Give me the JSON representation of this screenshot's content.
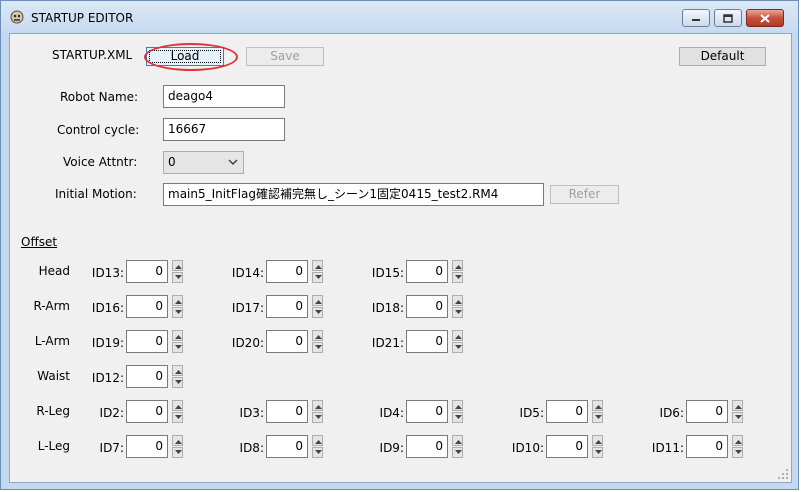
{
  "window": {
    "title": "STARTUP EDITOR",
    "buttons": {
      "minimize": "minimize",
      "maximize": "maximize",
      "close": "close"
    }
  },
  "toolbar": {
    "startup_xml_label": "STARTUP.XML",
    "load_label": "Load",
    "save_label": "Save",
    "default_label": "Default"
  },
  "form": {
    "robot_name_label": "Robot Name:",
    "robot_name_value": "deago4",
    "control_cycle_label": "Control cycle:",
    "control_cycle_value": "16667",
    "voice_attntr_label": "Voice Attntr:",
    "voice_attntr_value": "0",
    "initial_motion_label": "Initial Motion:",
    "initial_motion_value": "main5_InitFlag確認補完無し_シーン1固定0415_test2.RM4",
    "refer_label": "Refer"
  },
  "offset": {
    "title": "Offset",
    "rows": [
      {
        "label": "Head",
        "ids": [
          {
            "id": "ID13:",
            "value": "0"
          },
          {
            "id": "ID14:",
            "value": "0"
          },
          {
            "id": "ID15:",
            "value": "0"
          }
        ]
      },
      {
        "label": "R-Arm",
        "ids": [
          {
            "id": "ID16:",
            "value": "0"
          },
          {
            "id": "ID17:",
            "value": "0"
          },
          {
            "id": "ID18:",
            "value": "0"
          }
        ]
      },
      {
        "label": "L-Arm",
        "ids": [
          {
            "id": "ID19:",
            "value": "0"
          },
          {
            "id": "ID20:",
            "value": "0"
          },
          {
            "id": "ID21:",
            "value": "0"
          }
        ]
      },
      {
        "label": "Waist",
        "ids": [
          {
            "id": "ID12:",
            "value": "0"
          }
        ]
      },
      {
        "label": "R-Leg",
        "ids": [
          {
            "id": "ID2:",
            "value": "0"
          },
          {
            "id": "ID3:",
            "value": "0"
          },
          {
            "id": "ID4:",
            "value": "0"
          },
          {
            "id": "ID5:",
            "value": "0"
          },
          {
            "id": "ID6:",
            "value": "0"
          }
        ]
      },
      {
        "label": "L-Leg",
        "ids": [
          {
            "id": "ID7:",
            "value": "0"
          },
          {
            "id": "ID8:",
            "value": "0"
          },
          {
            "id": "ID9:",
            "value": "0"
          },
          {
            "id": "ID10:",
            "value": "0"
          },
          {
            "id": "ID11:",
            "value": "0"
          }
        ]
      }
    ]
  },
  "colors": {
    "highlight": "#e0333a",
    "titlebar": "#c6daf0"
  }
}
